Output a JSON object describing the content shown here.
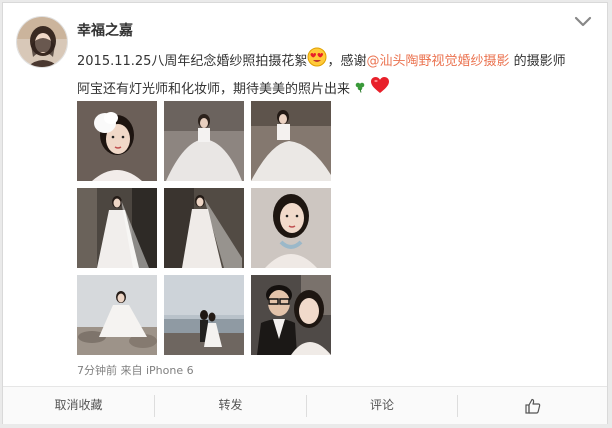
{
  "post": {
    "username": "幸福之嘉",
    "text_part1": "2015.11.25八周年纪念婚纱照拍摄花絮",
    "text_part2": "，感谢",
    "mention": "@汕头陶野视觉婚纱摄影",
    "text_part3": " 的摄影师阿宝还有灯光师和化妆师，期待美美的照片出来",
    "meta": "7分钟前 来自 iPhone 6",
    "icons": [
      "avatar-photo",
      "chevron-down-icon",
      "love-eyes-emoji",
      "clover-emoji",
      "heart-emoji"
    ],
    "photos": [
      {
        "name": "photo-bride-portrait-headpiece"
      },
      {
        "name": "photo-bride-sitting-gown"
      },
      {
        "name": "photo-bride-sitting-gown-closer"
      },
      {
        "name": "photo-bride-standing-veil"
      },
      {
        "name": "photo-bride-standing-side"
      },
      {
        "name": "photo-bride-closeup-necklace"
      },
      {
        "name": "photo-bride-sitting-beach-rocks"
      },
      {
        "name": "photo-couple-seaside"
      },
      {
        "name": "photo-couple-selfie"
      }
    ]
  },
  "actions": {
    "unfavorite": "取消收藏",
    "repost": "转发",
    "comment": "评论",
    "like_icon": "thumbs-up-icon"
  },
  "colors": {
    "link": "#eb7350",
    "text": "#333333",
    "meta": "#808080",
    "action_bg": "#fafafa"
  }
}
